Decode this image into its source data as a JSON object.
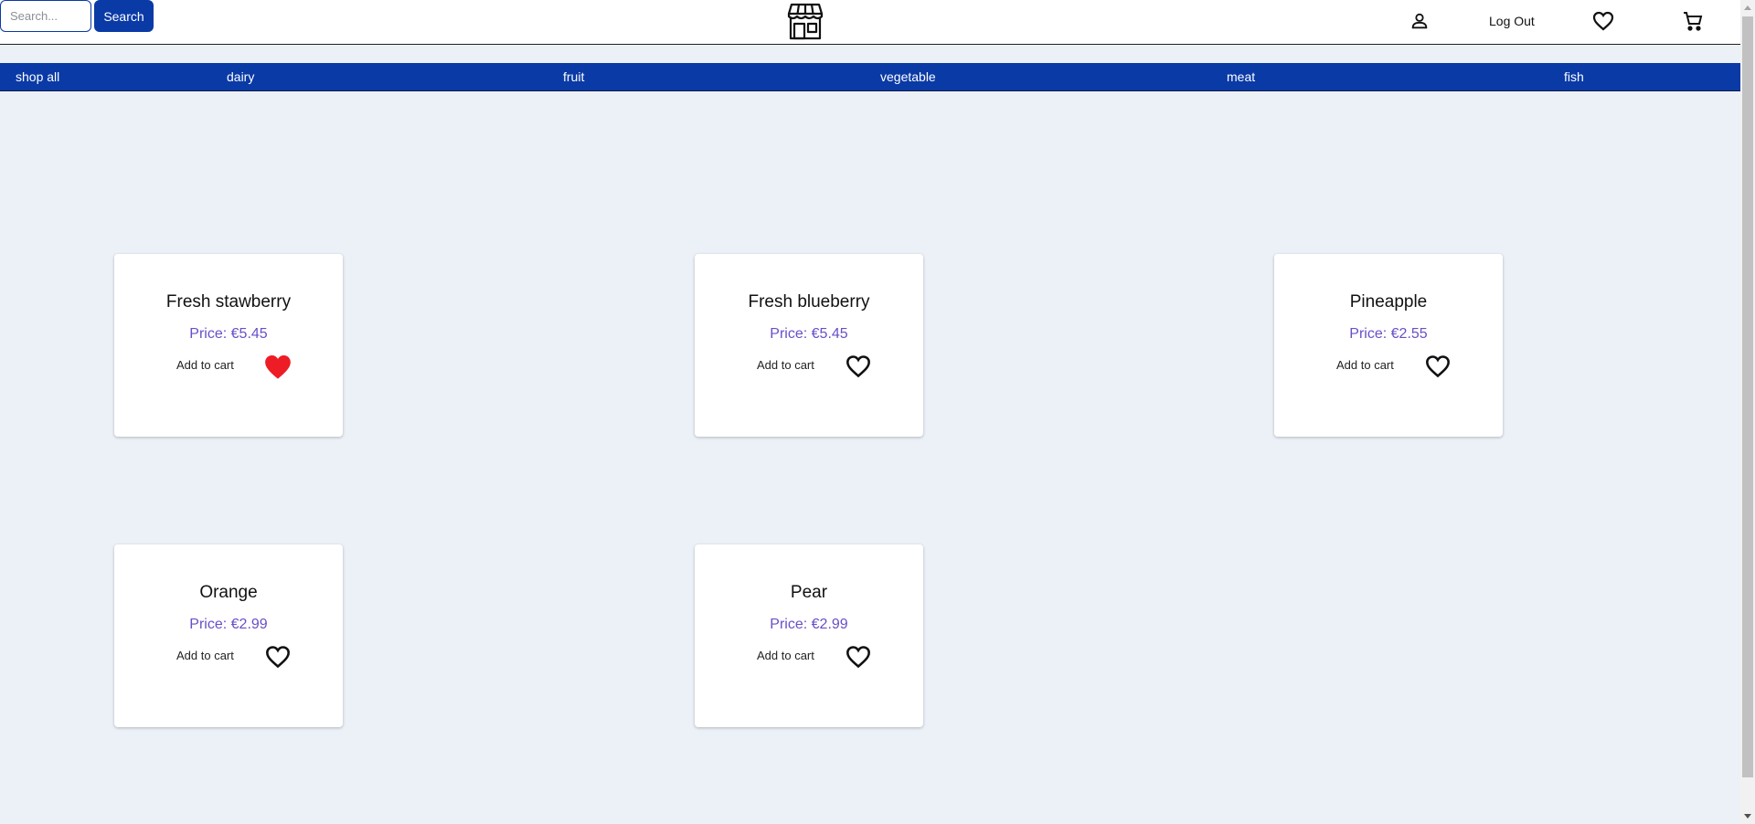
{
  "header": {
    "search_placeholder": "Search...",
    "search_label": "Search",
    "logo_icon": "storefront-icon",
    "account_icon": "person-icon",
    "logout_label": "Log Out",
    "wishlist_icon": "heart-outline-icon",
    "cart_icon": "shopping-cart-icon"
  },
  "nav": {
    "items": [
      {
        "label": "shop all"
      },
      {
        "label": "dairy"
      },
      {
        "label": "fruit"
      },
      {
        "label": "vegetable"
      },
      {
        "label": "meat"
      },
      {
        "label": "fish"
      }
    ]
  },
  "products": [
    {
      "name": "Fresh stawberry",
      "price": "Price: €5.45",
      "add_label": "Add to cart",
      "favorited": true
    },
    {
      "name": "Fresh blueberry",
      "price": "Price: €5.45",
      "add_label": "Add to cart",
      "favorited": false
    },
    {
      "name": "Pineapple",
      "price": "Price: €2.55",
      "add_label": "Add to cart",
      "favorited": false
    },
    {
      "name": "Orange",
      "price": "Price: €2.99",
      "add_label": "Add to cart",
      "favorited": false
    },
    {
      "name": "Pear",
      "price": "Price: €2.99",
      "add_label": "Add to cart",
      "favorited": false
    }
  ],
  "colors": {
    "brand": "#0a3aa6",
    "background": "#ecf1f8",
    "price": "#6a4fc8",
    "favorite_active": "#ee1c25"
  }
}
